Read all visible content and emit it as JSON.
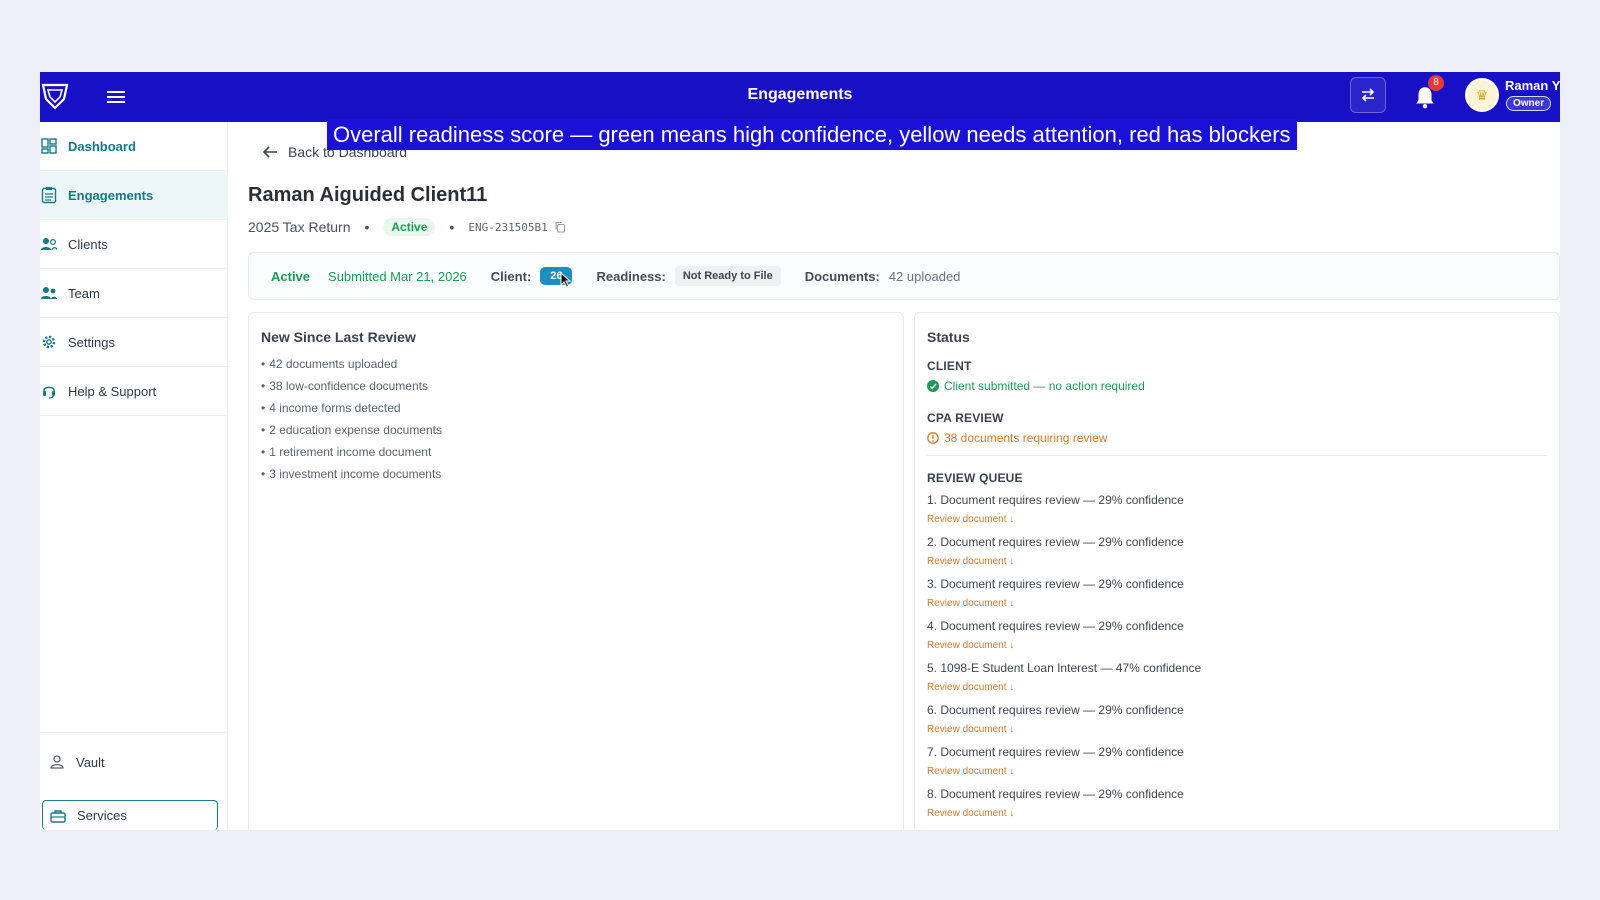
{
  "topbar": {
    "title": "Engagements",
    "notification_count": "8",
    "user_name": "Raman Y",
    "user_role": "Owner"
  },
  "caption": "Overall readiness score — green means high confidence, yellow needs attention, red has blockers",
  "sidebar": {
    "items": [
      {
        "label": "Dashboard",
        "icon": "dashboard-icon"
      },
      {
        "label": "Engagements",
        "icon": "clipboard-icon"
      },
      {
        "label": "Clients",
        "icon": "users-icon"
      },
      {
        "label": "Team",
        "icon": "team-icon"
      },
      {
        "label": "Settings",
        "icon": "gear-icon"
      },
      {
        "label": "Help & Support",
        "icon": "help-icon"
      }
    ],
    "bottom": [
      {
        "label": "Vault",
        "icon": "user-icon"
      },
      {
        "label": "Services",
        "icon": "briefcase-icon"
      }
    ]
  },
  "main": {
    "back_label": "Back to Dashboard",
    "client_name": "Raman Aiguided Client11",
    "return_type": "2025 Tax Return",
    "status": "Active",
    "engagement_code": "ENG-231505B1",
    "infobar": {
      "status": "Active",
      "submitted": "Submitted Mar 21, 2026",
      "client_label": "Client:",
      "client_score": "26",
      "readiness_label": "Readiness:",
      "readiness_value": "Not Ready to File",
      "documents_label": "Documents:",
      "documents_value": "42 uploaded"
    },
    "new_since": {
      "title": "New Since Last Review",
      "items": [
        "42 documents uploaded",
        "38 low-confidence documents",
        "4 income forms detected",
        "2 education expense documents",
        "1 retirement income document",
        "3 investment income documents"
      ]
    },
    "status_card": {
      "title": "Status",
      "client_label": "CLIENT",
      "client_status": "Client submitted — no action required",
      "cpa_label": "CPA REVIEW",
      "cpa_status": "38 documents requiring review",
      "queue_label": "REVIEW QUEUE",
      "review_link": "Review document ↓",
      "queue": [
        "1. Document requires review — 29% confidence",
        "2. Document requires review — 29% confidence",
        "3. Document requires review — 29% confidence",
        "4. Document requires review — 29% confidence",
        "5. 1098-E Student Loan Interest — 47% confidence",
        "6. Document requires review — 29% confidence",
        "7. Document requires review — 29% confidence",
        "8. Document requires review — 29% confidence"
      ]
    }
  },
  "colors": {
    "topbar": "#1710c4",
    "accent": "#137a8a",
    "success": "#1c9b57",
    "warning": "#d67a2b",
    "score_badge": "#1a8fc2"
  }
}
